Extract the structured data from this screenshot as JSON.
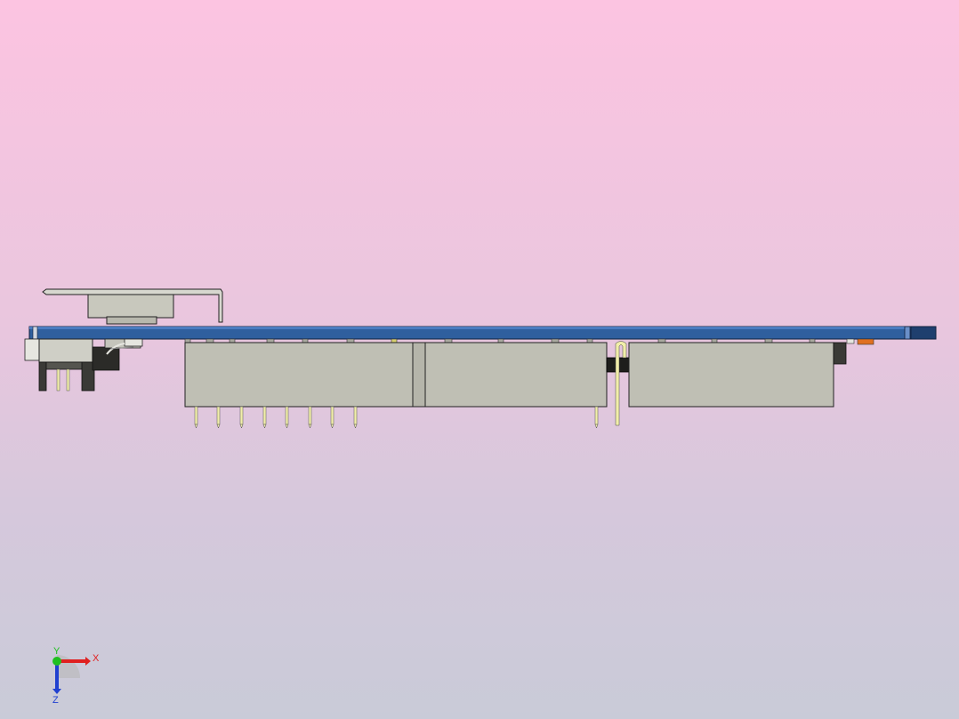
{
  "scene": {
    "view": "side",
    "background_top": "#fcc4e1",
    "background_bottom": "#c9cbd8",
    "pcb_color": "#2f5f9e",
    "connector_color": "#bfbfb4",
    "pin_color": "#f2eeaa"
  },
  "triad": {
    "x_label": "X",
    "y_label": "Y",
    "z_label": "Z",
    "x_color": "#e02020",
    "y_color": "#20c020",
    "z_color": "#2040d0"
  }
}
